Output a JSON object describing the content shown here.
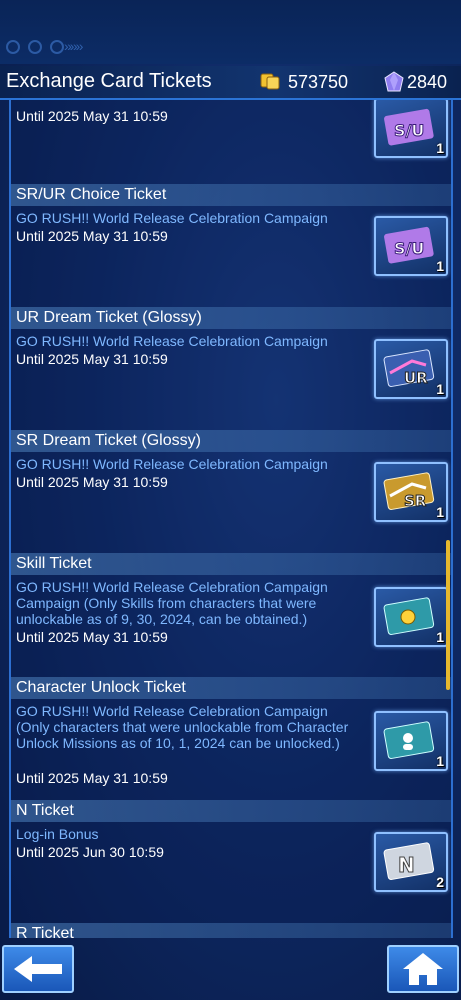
{
  "header": {
    "title": "Exchange Card Tickets",
    "gold_amount": "573750",
    "gem_amount": "2840"
  },
  "tickets": [
    {
      "name": "",
      "desc": "",
      "until": "Until 2025 May 31 10:59",
      "icon": "sr-ur-choice-ticket-icon",
      "qty": "1"
    },
    {
      "name": "SR/UR Choice Ticket",
      "desc": "GO RUSH!! World Release Celebration Campaign",
      "until": "Until 2025 May 31 10:59",
      "icon": "sr-ur-choice-ticket-icon",
      "qty": "1"
    },
    {
      "name": "UR Dream Ticket (Glossy)",
      "desc": "GO RUSH!! World Release Celebration Campaign",
      "until": "Until 2025 May 31 10:59",
      "icon": "ur-dream-ticket-icon",
      "qty": "1"
    },
    {
      "name": "SR Dream Ticket (Glossy)",
      "desc": "GO RUSH!! World Release Celebration Campaign",
      "until": "Until 2025 May 31 10:59",
      "icon": "sr-dream-ticket-icon",
      "qty": "1"
    },
    {
      "name": "Skill Ticket",
      "desc": "GO RUSH!! World Release Celebration Campaign Campaign (Only Skills from characters that were unlockable as of 9, 30, 2024, can be obtained.)",
      "until": "Until 2025 May 31 10:59",
      "icon": "skill-ticket-icon",
      "qty": "1"
    },
    {
      "name": "Character Unlock Ticket",
      "desc": "GO RUSH!! World Release Celebration Campaign (Only characters that were unlockable from Character Unlock Missions as of 10, 1, 2024 can be unlocked.)",
      "until": "Until 2025 May 31 10:59",
      "icon": "character-unlock-ticket-icon",
      "qty": "1"
    },
    {
      "name": "N Ticket",
      "desc": "Log-in Bonus",
      "until": "Until 2025 Jun 30 10:59",
      "icon": "n-ticket-icon",
      "qty": "2"
    },
    {
      "name": "R Ticket",
      "desc": "",
      "until": "",
      "icon": "r-ticket-icon",
      "qty": ""
    }
  ],
  "colors": {
    "accent_blue": "#2b74d6",
    "desc_text": "#7fb8ff",
    "scrollbar": "#e6b82e"
  }
}
